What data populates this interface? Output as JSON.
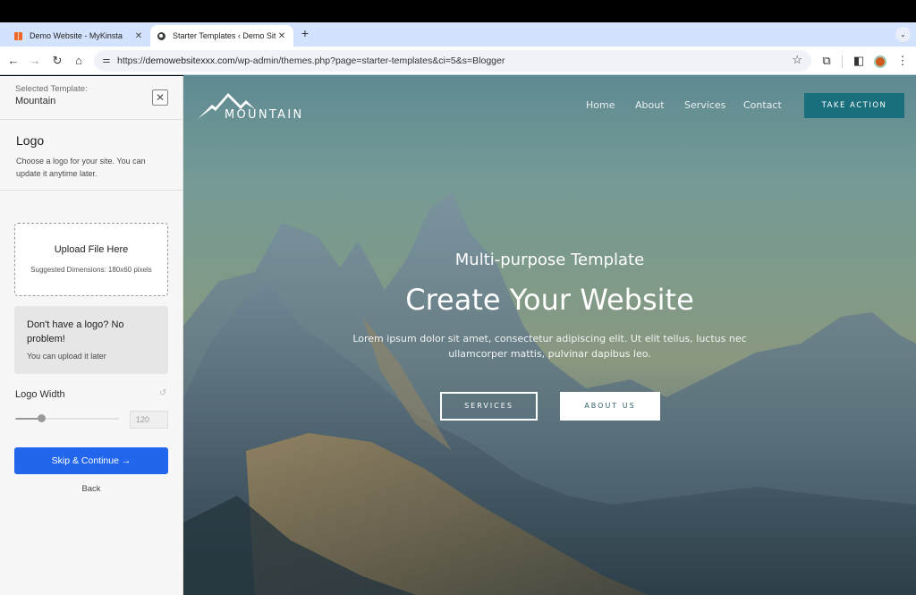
{
  "browser": {
    "tabs": [
      {
        "title": "Demo Website - MyKinsta",
        "icon": "kinsta-favicon",
        "active": false
      },
      {
        "title": "Starter Templates ‹ Demo Site",
        "icon": "globe-favicon",
        "active": true
      }
    ],
    "new_tab_label": "+",
    "tab_menu_icon": "⌄",
    "close_glyph": "✕",
    "url_scheme": "https://",
    "url_host": "demowebsitexxx.com",
    "url_path": "/wp-admin/themes.php?page=starter-templates&ci=5&s=Blogger",
    "icons": {
      "back": "←",
      "forward": "→",
      "reload": "↻",
      "home": "⌂",
      "tune": "⚌",
      "star": "☆",
      "extensions": "⧉",
      "sidepanel": "◧",
      "menu": "⋮"
    }
  },
  "sidebar": {
    "selected_label": "Selected Template:",
    "selected_name": "Mountain",
    "close_glyph": "✕",
    "section_title": "Logo",
    "section_desc": "Choose a logo for your site. You can update it anytime later.",
    "upload_title": "Upload File Here",
    "upload_sub": "Suggested Dimensions: 180x60 pixels",
    "nologo_title": "Don't have a logo? No problem!",
    "nologo_sub": "You can upload it later",
    "logo_width_label": "Logo Width",
    "reset_glyph": "↺",
    "logo_width_value": "120",
    "logo_width_slider_fraction": 0.25,
    "skip_label": "Skip & Continue  →",
    "back_label": "Back",
    "collapse_glyph": "‹",
    "accent_color": "#2166ec"
  },
  "preview": {
    "logo_text": "MOUNTAIN",
    "nav": [
      "Home",
      "About",
      "Services",
      "Contact"
    ],
    "cta": "TAKE ACTION",
    "cta_color": "#1a6f7d",
    "subtitle": "Multi-purpose Template",
    "title": "Create Your Website",
    "body": "Lorem ipsum dolor sit amet, consectetur adipiscing elit. Ut elit tellus, luctus nec ullamcorper mattis, pulvinar dapibus leo.",
    "btn_services": "SERVICES",
    "btn_about": "ABOUT US"
  }
}
